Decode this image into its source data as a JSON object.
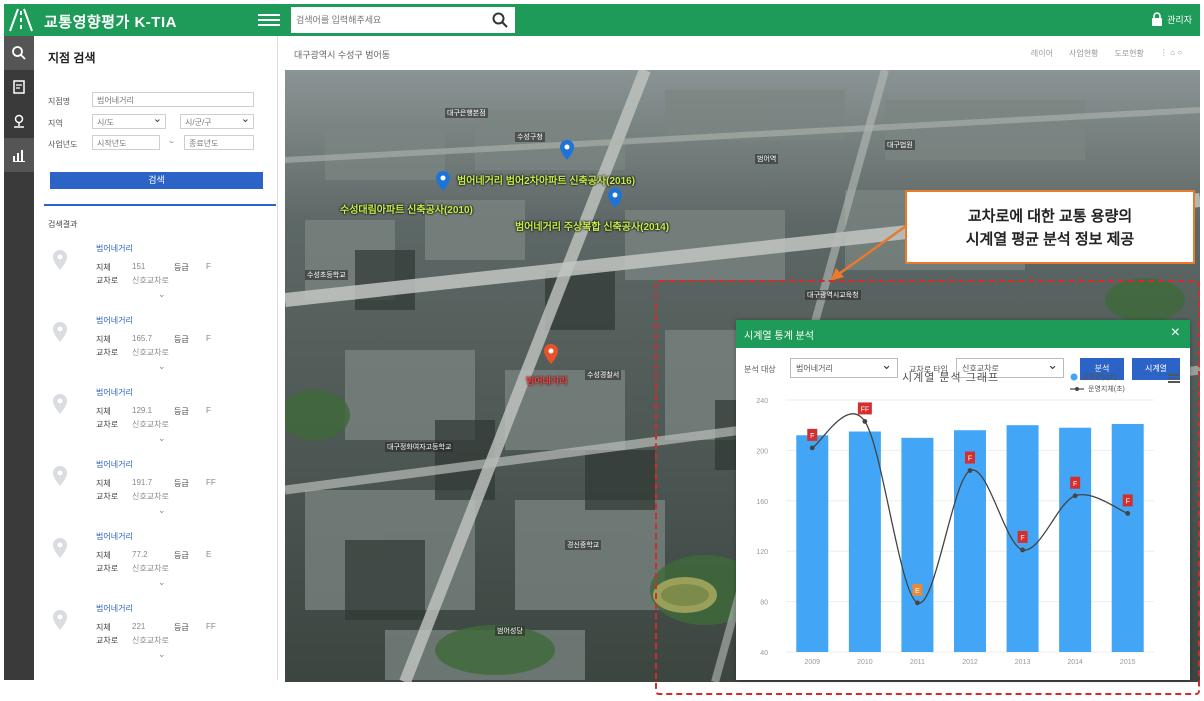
{
  "header": {
    "app_title": "교통영향평가 K-TIA",
    "search_placeholder": "검색어를 입력해주세요",
    "admin_label": "관리자"
  },
  "left_panel": {
    "title": "지점 검색",
    "form": {
      "name_label": "지점명",
      "name_value": "범어네거리",
      "region_label": "지역",
      "region_city": "시/도",
      "region_district": "시/군/구",
      "year_label": "사업년도",
      "year_start": "시작년도",
      "year_sep": "~",
      "year_end": "종료년도"
    },
    "search_button": "검색",
    "results_label": "검색결과",
    "results": [
      {
        "title": "범어네거리",
        "k1": "지체",
        "v1": "151",
        "k2": "등급",
        "v2": "F",
        "k3": "교차로",
        "v3": "신호교차로"
      },
      {
        "title": "범어네거리",
        "k1": "지체",
        "v1": "165.7",
        "k2": "등급",
        "v2": "F",
        "k3": "교차로",
        "v3": "신호교차로"
      },
      {
        "title": "범어네거리",
        "k1": "지체",
        "v1": "129.1",
        "k2": "등급",
        "v2": "F",
        "k3": "교차로",
        "v3": "신호교차로"
      },
      {
        "title": "범어네거리",
        "k1": "지체",
        "v1": "191.7",
        "k2": "등급",
        "v2": "FF",
        "k3": "교차로",
        "v3": "신호교차로"
      },
      {
        "title": "범어네거리",
        "k1": "지체",
        "v1": "77.2",
        "k2": "등급",
        "v2": "E",
        "k3": "교차로",
        "v3": "신호교차로"
      },
      {
        "title": "범어네거리",
        "k1": "지체",
        "v1": "221",
        "k2": "등급",
        "v2": "FF",
        "k3": "교차로",
        "v3": "신호교차로"
      }
    ]
  },
  "map": {
    "breadcrumb": "대구광역시 수성구 범어동",
    "tools": [
      "레이어",
      "사업현황",
      "도로현황"
    ],
    "green_labels": [
      "범어네거리 범어2차아파트 신축공사(2016)",
      "수성대림아파트 신축공사(2010)",
      "범어네거리 주상복합 신축공사(2014)"
    ],
    "red_label": "범어네거리",
    "poi_labels": [
      "대구은행본점",
      "수성구청",
      "범어역",
      "대구법원",
      "수성초등학교",
      "대구정화여자고등학교",
      "경신중학교",
      "범어성당",
      "대구광역시교육청",
      "수성경찰서"
    ],
    "callout": [
      "교차로에 대한 교통 용량의",
      "시계열 평균 분석 정보 제공"
    ]
  },
  "dialog": {
    "title": "시계열 통계 분석",
    "target_label": "분석 대상",
    "target_value": "범어네거리",
    "type_label": "교차로 타입",
    "type_value": "신호교차로",
    "btn_analyze": "분석",
    "btn_timeseries": "시계열",
    "chart_title": "시계열 분석 그래프",
    "legend_volume": "교통량(vph)",
    "legend_delay": "운영지체(초)"
  },
  "chart_data": {
    "type": "bar",
    "categories": [
      "2009",
      "2010",
      "2011",
      "2012",
      "2013",
      "2014",
      "2015"
    ],
    "series": [
      {
        "name": "교통량(vph)",
        "type": "bar",
        "values": [
          212,
          215,
          210,
          216,
          220,
          218,
          221
        ],
        "color": "#42a5f5"
      },
      {
        "name": "운영지체(초)",
        "type": "line",
        "values": [
          202,
          223,
          79,
          184,
          121,
          164,
          150
        ],
        "color": "#444444"
      }
    ],
    "point_labels": [
      "F",
      "FF",
      "E",
      "F",
      "F",
      "F",
      "F"
    ],
    "y_ticks": [
      40,
      80,
      120,
      160,
      200,
      240
    ],
    "ylim": [
      40,
      240
    ],
    "colors": {
      "bar": "#42a5f5",
      "line": "#444444",
      "label_F": "#d32f2f",
      "label_E": "#e8893a"
    }
  }
}
